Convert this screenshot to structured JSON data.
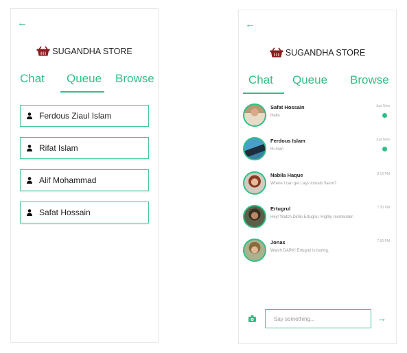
{
  "accent": "#2fbf86",
  "brand": {
    "name": "SUGANDHA STORE",
    "icon": "basket-icon",
    "icon_color": "#8b1d1d"
  },
  "tabs": [
    "Chat",
    "Queue",
    "Browse"
  ],
  "left_screen": {
    "active_tab": "Queue",
    "queue": [
      {
        "name": "Ferdous Ziaul Islam",
        "icon": "person-icon"
      },
      {
        "name": "Rifat Islam",
        "icon": "person-icon"
      },
      {
        "name": "Alif Mohammad",
        "icon": "person-icon"
      },
      {
        "name": "Safat Hossain",
        "icon": "person-icon"
      }
    ]
  },
  "right_screen": {
    "active_tab": "Chat",
    "chats": [
      {
        "name": "Safat Hossain",
        "message": "Hello",
        "time": "Just Now",
        "unread": true
      },
      {
        "name": "Ferdous Islam",
        "message": "Hi man",
        "time": "Just Now",
        "unread": true
      },
      {
        "name": "Nabila Haque",
        "message": "Where I can get Lays tomato flavor?",
        "time": "8:10 PM",
        "unread": false
      },
      {
        "name": "Ertugrul",
        "message": "Hey! Watch Dirilis Ertugrul. Highly recmender.",
        "time": "7:30 PM",
        "unread": false
      },
      {
        "name": "Jonas",
        "message": "Watch DARK! Ertugrul is boring.",
        "time": "7:30 PM",
        "unread": false
      }
    ],
    "composer": {
      "placeholder": "Say something...",
      "camera_icon": "camera-icon",
      "send_icon": "send-arrow-icon"
    }
  }
}
